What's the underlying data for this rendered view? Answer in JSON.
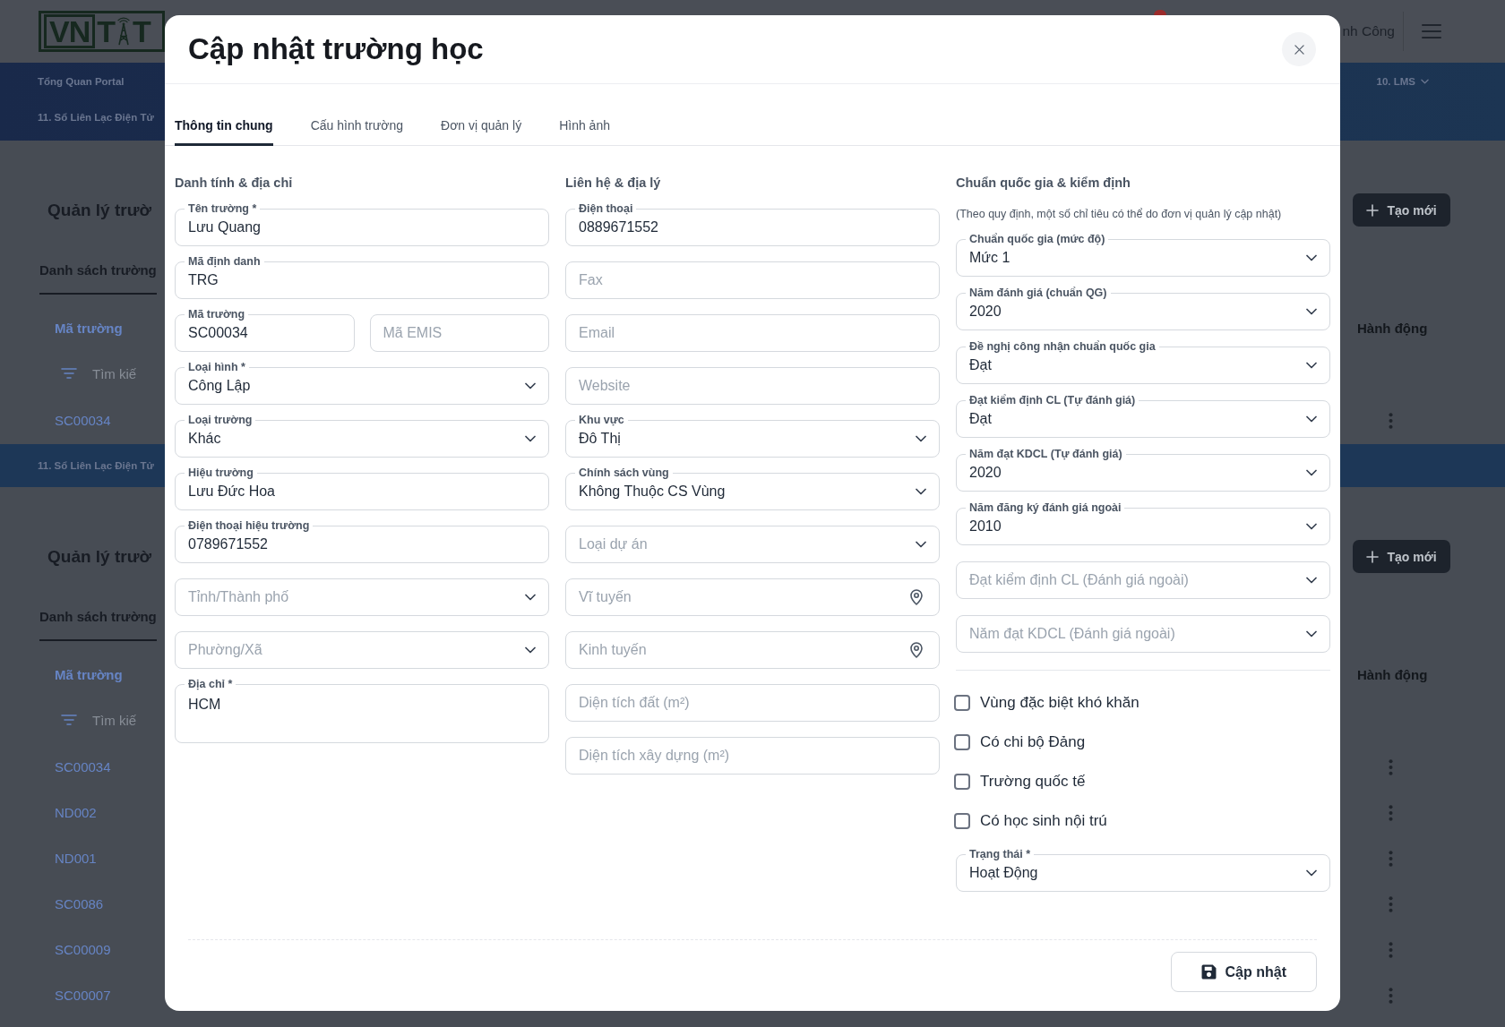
{
  "background_page": {
    "header": {
      "logo": {
        "letters": [
          "VN",
          "T",
          "T"
        ]
      },
      "user_name": "nh Công"
    },
    "blocks": [
      {
        "kind": "nav",
        "rows": [
          {
            "left": "Tổng Quan Portal",
            "right": "10. LMS"
          },
          {
            "left": "11. Sổ Liên Lạc Điện Tử"
          }
        ]
      },
      {
        "kind": "panel",
        "title": "Quản lý trườ",
        "create_button": "Tạo mới",
        "tabs": [
          {
            "label": "Danh sách trường",
            "selected": true
          }
        ],
        "columns": [
          "Mã trường",
          "Hành động"
        ],
        "search": {
          "placeholder": "Tìm kiế"
        },
        "rows": [
          {
            "code": "SC00034"
          }
        ]
      },
      {
        "kind": "nav",
        "rows": [
          {
            "left": "11. Sổ Liên Lạc Điện Tử"
          }
        ]
      },
      {
        "kind": "panel",
        "title": "Quản lý trườ",
        "create_button": "Tạo mới",
        "tabs": [
          {
            "label": "Danh sách trường",
            "selected": true
          }
        ],
        "columns": [
          "Mã trường",
          "Hành động"
        ],
        "search": {
          "placeholder": "Tìm kiế"
        },
        "rows": [
          {
            "code": "SC00034"
          },
          {
            "code": "ND002"
          },
          {
            "code": "ND001"
          },
          {
            "code": "SC0086"
          },
          {
            "code": "SC00009"
          },
          {
            "code": "SC00007"
          }
        ]
      }
    ]
  },
  "modal": {
    "title": "Cập nhật trường học",
    "tabs": [
      {
        "label": "Thông tin chung",
        "selected": true
      },
      {
        "label": "Cấu hình trường",
        "selected": false
      },
      {
        "label": "Đơn vị quản lý",
        "selected": false
      },
      {
        "label": "Hình ảnh",
        "selected": false
      }
    ],
    "columns": [
      {
        "heading": "Danh tính & địa chỉ",
        "fields": [
          {
            "kind": "text",
            "label": "Tên trường *",
            "value": "Lưu Quang"
          },
          {
            "kind": "text",
            "label": "Mã định danh",
            "value": "TRG"
          },
          {
            "kind": "pair",
            "items": [
              {
                "kind": "text",
                "label": "Mã trường",
                "value": "SC00034"
              },
              {
                "kind": "text",
                "placeholder": "Mã EMIS"
              }
            ]
          },
          {
            "kind": "select",
            "label": "Loại hình *",
            "value": "Công Lập"
          },
          {
            "kind": "select",
            "label": "Loại trường",
            "value": "Khác"
          },
          {
            "kind": "text",
            "label": "Hiệu trường",
            "value": "Lưu Đức Hoa"
          },
          {
            "kind": "text",
            "label": "Điện thoại hiệu trường",
            "value": "0789671552"
          },
          {
            "kind": "select",
            "placeholder": "Tỉnh/Thành phố"
          },
          {
            "kind": "select",
            "placeholder": "Phường/Xã"
          },
          {
            "kind": "textarea",
            "label": "Địa chỉ *",
            "value": "HCM"
          }
        ]
      },
      {
        "heading": "Liên hệ & địa lý",
        "fields": [
          {
            "kind": "text",
            "label": "Điện thoại",
            "value": "0889671552"
          },
          {
            "kind": "text",
            "placeholder": "Fax"
          },
          {
            "kind": "text",
            "placeholder": "Email"
          },
          {
            "kind": "text",
            "placeholder": "Website"
          },
          {
            "kind": "select",
            "label": "Khu vực",
            "value": "Đô Thị"
          },
          {
            "kind": "select",
            "label": "Chính sách vùng",
            "value": "Không Thuộc CS Vùng"
          },
          {
            "kind": "select",
            "placeholder": "Loại dự án"
          },
          {
            "kind": "location",
            "placeholder": "Vĩ tuyến"
          },
          {
            "kind": "location",
            "placeholder": "Kinh tuyến"
          },
          {
            "kind": "text",
            "placeholder": "Diện tích đất (m²)"
          },
          {
            "kind": "text",
            "placeholder": "Diện tích xây dựng (m²)"
          }
        ]
      },
      {
        "heading": "Chuẩn quốc gia & kiểm định",
        "note": "(Theo quy định, một số chỉ tiêu có thể do đơn vị quản lý cập nhật)",
        "fields": [
          {
            "kind": "select",
            "label": "Chuẩn quốc gia (mức độ)",
            "value": "Mức 1"
          },
          {
            "kind": "select",
            "label": "Năm đánh giá (chuẩn QG)",
            "value": "2020"
          },
          {
            "kind": "select",
            "label": "Đề nghị công nhận chuẩn quốc gia",
            "value": "Đạt"
          },
          {
            "kind": "select",
            "label": "Đạt kiểm định CL (Tự đánh giá)",
            "value": "Đạt"
          },
          {
            "kind": "select",
            "label": "Năm đạt KDCL (Tự đánh giá)",
            "value": "2020"
          },
          {
            "kind": "select",
            "label": "Năm đăng ký đánh giá ngoài",
            "value": "2010"
          },
          {
            "kind": "select",
            "placeholder": "Đạt kiểm định CL (Đánh giá ngoài)"
          },
          {
            "kind": "select",
            "placeholder": "Năm đạt KDCL (Đánh giá ngoài)"
          }
        ],
        "checkboxes": [
          {
            "label": "Vùng đặc biệt khó khăn",
            "checked": false
          },
          {
            "label": "Có chi bộ Đảng",
            "checked": false
          },
          {
            "label": "Trường quốc tế",
            "checked": false
          },
          {
            "label": "Có học sinh nội trú",
            "checked": false
          }
        ],
        "fields_after": [
          {
            "kind": "select",
            "label": "Trạng thái *",
            "value": "Hoạt Động"
          }
        ]
      }
    ],
    "submit_button": "Cập nhật"
  }
}
